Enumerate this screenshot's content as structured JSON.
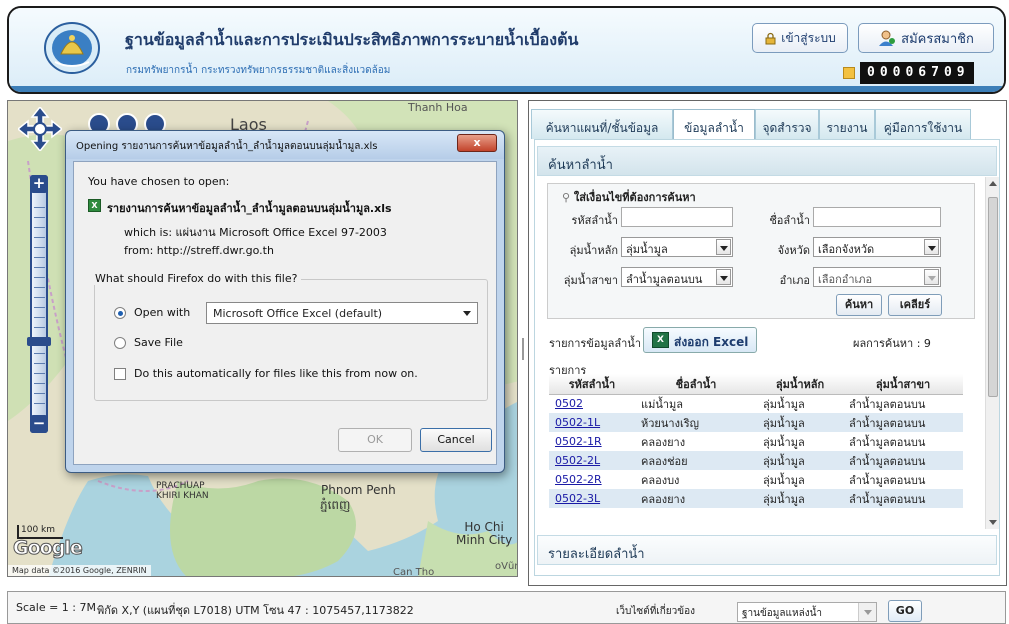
{
  "header": {
    "title": "ฐานข้อมูลลำน้ำและการประเมินประสิทธิภาพการระบายน้ำเบื้องต้น",
    "subtitle": "กรมทรัพยากรน้ำ  กระทรวงทรัพยากรธรรมชาติและสิ่งแวดล้อม",
    "login_label": "เข้าสู่ระบบ",
    "register_label": "สมัครสมาชิก",
    "visitor_counter": "00006709"
  },
  "map": {
    "labels": {
      "laos": "Laos",
      "thanh_hoa": "Thanh Hoa",
      "phnom_penh": "Phnom Penh",
      "phnom_penh_km": "ភ្នំពេញ",
      "ho_chi_minh_1": "Ho Chi",
      "ho_chi_minh_2": "Minh City",
      "prachuap": "PRACHUAP",
      "khiri_khan": "KHIRI KHAN",
      "can_tho": "Can Tho",
      "vung": "oVũr"
    },
    "scale_label": "100 km",
    "google_logo": "Google",
    "attribution": "Map data ©2016 Google, ZENRIN"
  },
  "dialog": {
    "title": "Opening รายงานการค้นหาข้อมูลลำน้ำ_ลำน้ำมูลตอนบนลุ่มน้ำมูล.xls",
    "close_label": "x",
    "chosen_text": "You have chosen to open:",
    "file_name": "รายงานการค้นหาข้อมูลลำน้ำ_ลำน้ำมูลตอนบนลุ่มน้ำมูล.xls",
    "which_is": "which is:  แผ่นงาน Microsoft Office Excel 97-2003",
    "from": "from:  http://streff.dwr.go.th",
    "question": "What should Firefox do with this file?",
    "open_with_label": "Open with",
    "open_with_app": "Microsoft Office Excel (default)",
    "save_file_label": "Save File",
    "auto_label": "Do this automatically for files like this from now on.",
    "ok_label": "OK",
    "cancel_label": "Cancel"
  },
  "tabs": [
    {
      "label": "ค้นหาแผนที่/ชั้นข้อมูล"
    },
    {
      "label": "ข้อมูลลำน้ำ",
      "active": true
    },
    {
      "label": "จุดสำรวจ"
    },
    {
      "label": "รายงาน"
    },
    {
      "label": "คู่มือการใช้งาน"
    }
  ],
  "search": {
    "section_title": "ค้นหาลำน้ำ",
    "hint": "ใส่เงื่อนไขที่ต้องการค้นหา",
    "river_code_label": "รหัสลำน้ำ",
    "river_name_label": "ชื่อลำน้ำ",
    "main_basin_label": "ลุ่มน้ำหลัก",
    "main_basin_value": "ลุ่มน้ำมูล",
    "province_label": "จังหวัด",
    "province_value": "เลือกจังหวัด",
    "sub_basin_label": "ลุ่มน้ำสาขา",
    "sub_basin_value": "ลำน้ำมูลตอนบน",
    "district_label": "อำเภอ",
    "district_value": "เลือกอำเภอ",
    "search_button": "ค้นหา",
    "clear_button": "เคลียร์"
  },
  "results": {
    "list_label": "รายการข้อมูลลำน้ำ",
    "export_label": "ส่งออก Excel",
    "count_text": "ผลการค้นหา : 9",
    "items_label": "รายการ",
    "columns": [
      "รหัสลำน้ำ",
      "ชื่อลำน้ำ",
      "ลุ่มน้ำหลัก",
      "ลุ่มน้ำสาขา"
    ],
    "rows": [
      [
        "0502",
        "แม่น้ำมูล",
        "ลุ่มน้ำมูล",
        "ลำน้ำมูลตอนบน"
      ],
      [
        "0502-1L",
        "ห้วยนางเริญ",
        "ลุ่มน้ำมูล",
        "ลำน้ำมูลตอนบน"
      ],
      [
        "0502-1R",
        "คลองยาง",
        "ลุ่มน้ำมูล",
        "ลำน้ำมูลตอนบน"
      ],
      [
        "0502-2L",
        "คลองช่อย",
        "ลุ่มน้ำมูล",
        "ลำน้ำมูลตอนบน"
      ],
      [
        "0502-2R",
        "คลองบง",
        "ลุ่มน้ำมูล",
        "ลำน้ำมูลตอนบน"
      ],
      [
        "0502-3L",
        "คลองยาง",
        "ลุ่มน้ำมูล",
        "ลำน้ำมูลตอนบน"
      ]
    ],
    "detail_title": "รายละเอียดลำน้ำ"
  },
  "status": {
    "scale": "Scale = 1 : 7M",
    "coords": "พิกัด X,Y (แผนที่ชุด L7018) UTM โซน 47 : 1075457,1173822",
    "related_label": "เว็บไซต์ที่เกี่ยวข้อง",
    "related_value": "ฐานข้อมูลแหล่งน้ำ",
    "go_label": "GO"
  }
}
